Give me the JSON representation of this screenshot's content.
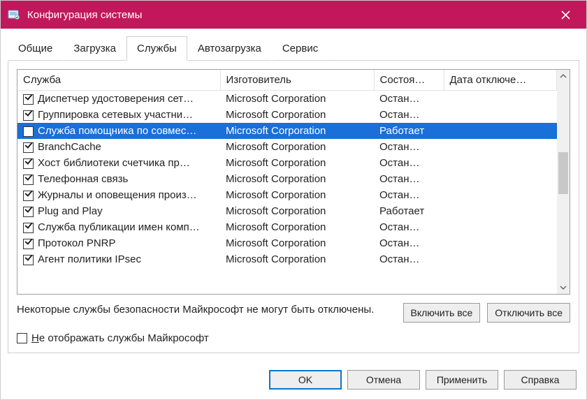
{
  "window": {
    "title": "Конфигурация системы"
  },
  "tabs": {
    "general": "Общие",
    "boot": "Загрузка",
    "services": "Службы",
    "startup": "Автозагрузка",
    "tools": "Сервис",
    "active": "services"
  },
  "columns": {
    "service": "Служба",
    "manufacturer": "Изготовитель",
    "status": "Состоя…",
    "date_disabled": "Дата отключе…"
  },
  "rows": [
    {
      "checked": true,
      "name": "Диспетчер удостоверения сет…",
      "mfr": "Microsoft Corporation",
      "status": "Остан…",
      "date": "",
      "selected": false
    },
    {
      "checked": true,
      "name": "Группировка сетевых участни…",
      "mfr": "Microsoft Corporation",
      "status": "Остан…",
      "date": "",
      "selected": false
    },
    {
      "checked": false,
      "name": "Служба помощника по совмес…",
      "mfr": "Microsoft Corporation",
      "status": "Работает",
      "date": "",
      "selected": true
    },
    {
      "checked": true,
      "name": "BranchCache",
      "mfr": "Microsoft Corporation",
      "status": "Остан…",
      "date": "",
      "selected": false
    },
    {
      "checked": true,
      "name": "Хост библиотеки счетчика пр…",
      "mfr": "Microsoft Corporation",
      "status": "Остан…",
      "date": "",
      "selected": false
    },
    {
      "checked": true,
      "name": "Телефонная связь",
      "mfr": "Microsoft Corporation",
      "status": "Остан…",
      "date": "",
      "selected": false
    },
    {
      "checked": true,
      "name": "Журналы и оповещения произ…",
      "mfr": "Microsoft Corporation",
      "status": "Остан…",
      "date": "",
      "selected": false
    },
    {
      "checked": true,
      "name": "Plug and Play",
      "mfr": "Microsoft Corporation",
      "status": "Работает",
      "date": "",
      "selected": false
    },
    {
      "checked": true,
      "name": "Служба публикации имен комп…",
      "mfr": "Microsoft Corporation",
      "status": "Остан…",
      "date": "",
      "selected": false
    },
    {
      "checked": true,
      "name": "Протокол PNRP",
      "mfr": "Microsoft Corporation",
      "status": "Остан…",
      "date": "",
      "selected": false
    },
    {
      "checked": true,
      "name": "Агент политики IPsec",
      "mfr": "Microsoft Corporation",
      "status": "Остан…",
      "date": "",
      "selected": false
    }
  ],
  "panel": {
    "info": "Некоторые службы безопасности Майкрософт не могут быть отключены.",
    "enable_all": "Включить все",
    "disable_all": "Отключить все",
    "hide_ms_prefix": "Н",
    "hide_ms_rest": "е отображать службы Майкрософт",
    "hide_ms_checked": false
  },
  "footer": {
    "ok": "OK",
    "cancel": "Отмена",
    "apply": "Применить",
    "help": "Справка"
  }
}
